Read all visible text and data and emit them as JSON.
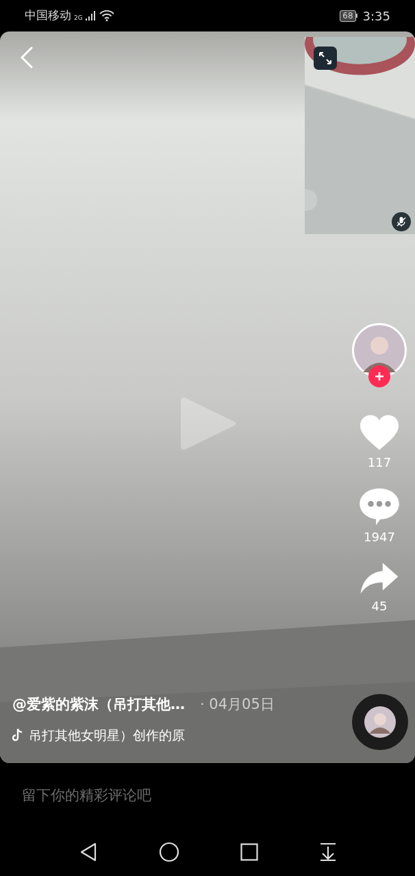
{
  "status_bar": {
    "carrier": "中国移动",
    "network": "2G",
    "battery": "68",
    "time": "3:35"
  },
  "video": {
    "paused": true
  },
  "pip": {
    "muted": true
  },
  "author": {
    "following": false
  },
  "actions": [
    {
      "kind": "like",
      "count": "117",
      "liked": false
    },
    {
      "kind": "comment",
      "count": "1947"
    },
    {
      "kind": "share",
      "count": "45"
    }
  ],
  "caption": {
    "author": "@爱紫的紫沫（吊打其他…",
    "date": "· 04月05日",
    "music": "吊打其他女明星）创作的原"
  },
  "comment": {
    "placeholder": "留下你的精彩评论吧"
  }
}
